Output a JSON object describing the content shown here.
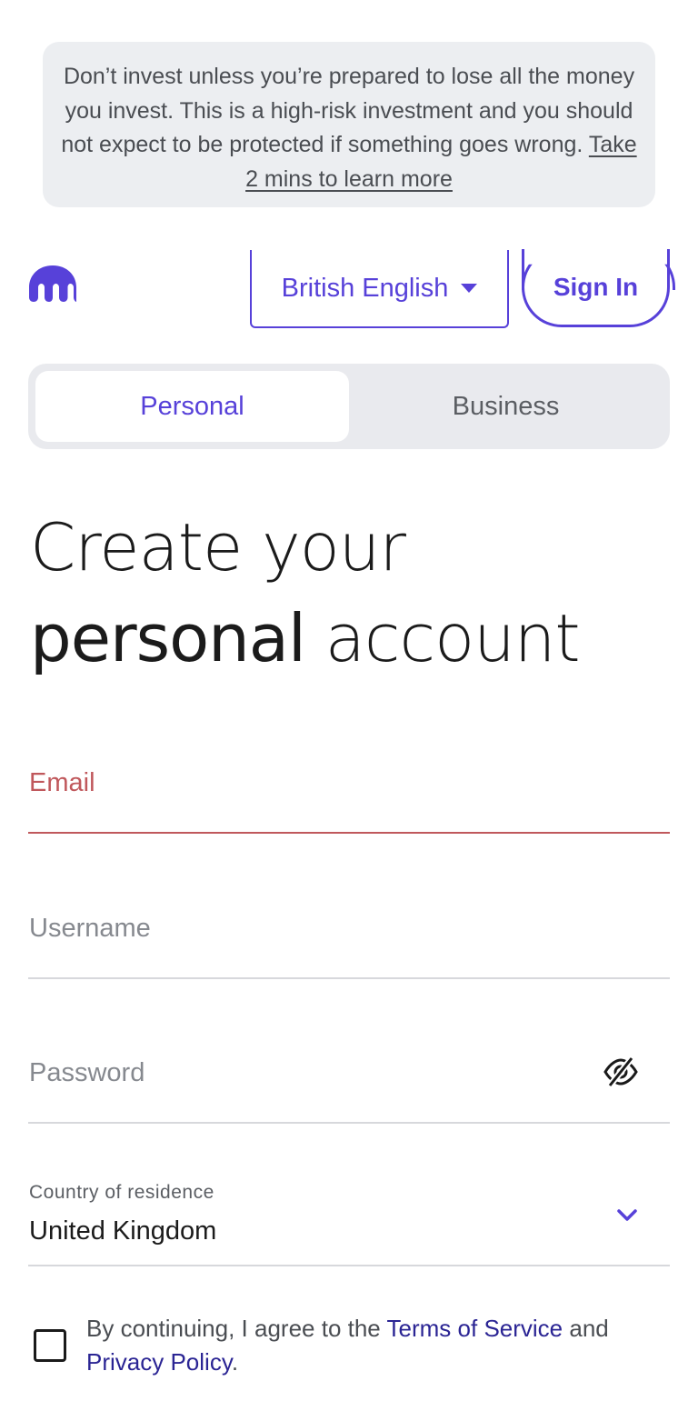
{
  "risk_banner": {
    "text": "Don’t invest unless you’re prepared to lose all the money you invest. This is a high-risk investment and you should not expect to be protected if something goes wrong. ",
    "link": "Take 2 mins to learn more"
  },
  "header": {
    "logo_icon": "kraken-logo-icon",
    "language": "British English",
    "sign_in": "Sign In"
  },
  "account_type": {
    "tabs": [
      {
        "label": "Personal",
        "active": true
      },
      {
        "label": "Business",
        "active": false
      }
    ]
  },
  "heading": {
    "line1": "Create your",
    "bold": "personal",
    "rest": " account"
  },
  "form": {
    "email_label": "Email",
    "username_label": "Username",
    "password_label": "Password",
    "password_toggle_icon": "eye-slash-icon",
    "country_label": "Country of residence",
    "country_value": "United Kingdom"
  },
  "consent": {
    "prefix": "By continuing, I agree to the ",
    "terms": "Terms of Service",
    "middle": " and ",
    "privacy": "Privacy Policy",
    "suffix": "."
  },
  "colors": {
    "accent": "#5741d9",
    "error": "#c0585c",
    "banner_bg": "#eceef1"
  }
}
